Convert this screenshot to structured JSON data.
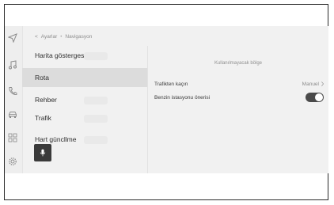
{
  "breadcrumb": {
    "back_glyph": "<",
    "parent": "Ayarlar",
    "separator": "•",
    "current": "Navigasyon"
  },
  "rail_icons": [
    "navigation-icon",
    "music-icon",
    "phone-icon",
    "car-icon",
    "apps-icon",
    "settings-icon"
  ],
  "menu": {
    "items": [
      {
        "label": "Harita göstergesi"
      },
      {
        "label": "Rota"
      },
      {
        "label": "Rehber"
      },
      {
        "label": "Trafik"
      },
      {
        "label": "Hart güncllme"
      }
    ],
    "active_index": 1
  },
  "panel": {
    "section_title": "Kullanılmayacak bölge",
    "traffic_avoid": {
      "label": "Trafikten kaçın",
      "value": "Manuel"
    },
    "gas_station": {
      "label": "Benzin istasyonu önerisi",
      "toggle_on": true
    }
  },
  "colors": {
    "screen_bg": "#f1f1f1",
    "active_item_bg": "#dcdcdc",
    "toggle_on": "#4a4a4a",
    "mic_button": "#3a3a3a"
  }
}
